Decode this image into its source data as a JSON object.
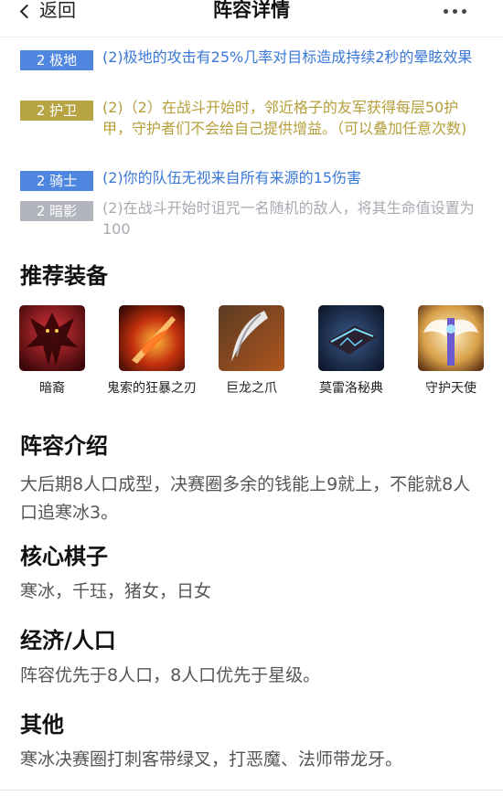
{
  "nav": {
    "back_label": "返回",
    "title": "阵容详情"
  },
  "traits": [
    {
      "badge": "2 极地",
      "badge_color": "#4f86e0",
      "text_color": "#3a78d8",
      "desc": "(2)极地的攻击有25%几率对目标造成持续2秒的晕眩效果"
    },
    {
      "badge": "2 护卫",
      "badge_color": "#b7a544",
      "text_color": "#b59e3a",
      "desc": "(2)（2）在战斗开始时，邻近格子的友军获得每层50护甲，守护者们不会给自己提供增益。（可以叠加任意次数)"
    },
    {
      "badge": "2 骑士",
      "badge_color": "#4f86e0",
      "text_color": "#3a78d8",
      "desc": "(2)你的队伍无视来自所有来源的15伤害"
    },
    {
      "badge": "2 暗影",
      "badge_color": "#b3b5be",
      "text_color": "#a8aab2",
      "desc": "(2)在战斗开始时诅咒一名随机的敌人，将其生命值设置为100"
    }
  ],
  "equipment": {
    "title": "推荐装备",
    "items": [
      {
        "name": "暗裔",
        "icon": "darkin-icon"
      },
      {
        "name": "鬼索的狂暴之刃",
        "icon": "guinsoo-rageblade-icon"
      },
      {
        "name": "巨龙之爪",
        "icon": "dragon-claw-icon"
      },
      {
        "name": "莫雷洛秘典",
        "icon": "morellonomicon-icon"
      },
      {
        "name": "守护天使",
        "icon": "guardian-angel-icon"
      }
    ]
  },
  "intro": {
    "title": "阵容介绍",
    "text": "大后期8人口成型，决赛圈多余的钱能上9就上，不能就8人口追寒冰3。"
  },
  "core": {
    "title": "核心棋子",
    "text": "寒冰，千珏，猪女，日女"
  },
  "economy": {
    "title": "经济/人口",
    "text": "阵容优先于8人口，8人口优先于星级。"
  },
  "other": {
    "title": "其他",
    "text": "寒冰决赛圈打刺客带绿叉，打恶魔、法师带龙牙。"
  }
}
